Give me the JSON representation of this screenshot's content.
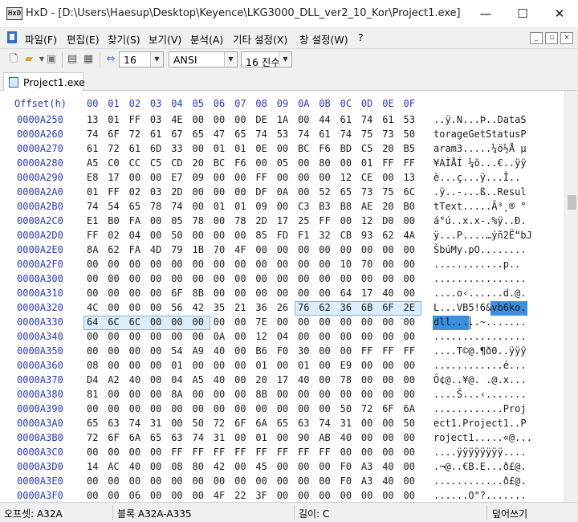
{
  "window": {
    "app_icon_text": "HxD",
    "title": "HxD - [D:\\Users\\Haesup\\Desktop\\Keyence\\LKG3000_DLL_ver2_10_Kor\\Project1.exe]",
    "minimize_glyph": "—",
    "maximize_glyph": "☐",
    "close_glyph": "✕"
  },
  "menu": {
    "items": [
      "파일(F)",
      "편집(E)",
      "찾기(S)",
      "보기(V)",
      "분석(A)",
      "기타 설정(X)",
      "창 설정(W)",
      "?"
    ],
    "mdi_buttons": [
      "_",
      "▫",
      "×"
    ]
  },
  "toolbar": {
    "bytes_per_row": "16",
    "charset": "ANSI",
    "offset_base": "16 진수"
  },
  "tab": {
    "label": "Project1.exe"
  },
  "editor": {
    "header_label": "Offset(h)",
    "column_headers": [
      "00",
      "01",
      "02",
      "03",
      "04",
      "05",
      "06",
      "07",
      "08",
      "09",
      "0A",
      "0B",
      "0C",
      "0D",
      "0E",
      "0F"
    ],
    "rows": [
      {
        "offset": "0000A250",
        "bytes": [
          "13",
          "01",
          "FF",
          "03",
          "4E",
          "00",
          "00",
          "00",
          "DE",
          "1A",
          "00",
          "44",
          "61",
          "74",
          "61",
          "53"
        ],
        "ascii": "..ÿ.N...Þ..DataS"
      },
      {
        "offset": "0000A260",
        "bytes": [
          "74",
          "6F",
          "72",
          "61",
          "67",
          "65",
          "47",
          "65",
          "74",
          "53",
          "74",
          "61",
          "74",
          "75",
          "73",
          "50"
        ],
        "ascii": "torageGetStatusP"
      },
      {
        "offset": "0000A270",
        "bytes": [
          "61",
          "72",
          "61",
          "6D",
          "33",
          "00",
          "01",
          "01",
          "0E",
          "00",
          "BC",
          "F6",
          "BD",
          "C5",
          "20",
          "B5"
        ],
        "ascii": "aram3.....¼ö½Å µ"
      },
      {
        "offset": "0000A280",
        "bytes": [
          "A5",
          "C0",
          "CC",
          "C5",
          "CD",
          "20",
          "BC",
          "F6",
          "00",
          "05",
          "00",
          "80",
          "00",
          "01",
          "FF",
          "FF"
        ],
        "ascii": "¥ÀÌÅÍ ¼ö...€..ÿÿ"
      },
      {
        "offset": "0000A290",
        "bytes": [
          "E8",
          "17",
          "00",
          "00",
          "E7",
          "09",
          "00",
          "00",
          "FF",
          "00",
          "00",
          "00",
          "12",
          "CE",
          "00",
          "13"
        ],
        "ascii": "è...ç...ÿ...Î.."
      },
      {
        "offset": "0000A2A0",
        "bytes": [
          "01",
          "FF",
          "02",
          "03",
          "2D",
          "00",
          "00",
          "00",
          "DF",
          "0A",
          "00",
          "52",
          "65",
          "73",
          "75",
          "6C"
        ],
        "ascii": ".ÿ..-...ß..Resul"
      },
      {
        "offset": "0000A2B0",
        "bytes": [
          "74",
          "54",
          "65",
          "78",
          "74",
          "00",
          "01",
          "01",
          "09",
          "00",
          "C3",
          "B3",
          "B8",
          "AE",
          "20",
          "B0"
        ],
        "ascii": "tText.....Ã³¸® °"
      },
      {
        "offset": "0000A2C0",
        "bytes": [
          "E1",
          "B0",
          "FA",
          "00",
          "05",
          "78",
          "00",
          "78",
          "2D",
          "17",
          "25",
          "FF",
          "00",
          "12",
          "D0",
          "00"
        ],
        "ascii": "á°ú..x.x-.%ÿ..Ð."
      },
      {
        "offset": "0000A2D0",
        "bytes": [
          "FF",
          "02",
          "04",
          "00",
          "50",
          "00",
          "00",
          "00",
          "85",
          "FD",
          "F1",
          "32",
          "CB",
          "93",
          "62",
          "4A"
        ],
        "ascii": "ÿ...P....…ýñ2Ë“bJ"
      },
      {
        "offset": "0000A2E0",
        "bytes": [
          "8A",
          "62",
          "FA",
          "4D",
          "79",
          "1B",
          "70",
          "4F",
          "00",
          "00",
          "00",
          "00",
          "00",
          "00",
          "00",
          "00"
        ],
        "ascii": "ŠbúMy.pO........"
      },
      {
        "offset": "0000A2F0",
        "bytes": [
          "00",
          "00",
          "00",
          "00",
          "00",
          "00",
          "00",
          "00",
          "00",
          "00",
          "00",
          "00",
          "10",
          "70",
          "00",
          "00"
        ],
        "ascii": "............p.."
      },
      {
        "offset": "0000A300",
        "bytes": [
          "00",
          "00",
          "00",
          "00",
          "00",
          "00",
          "00",
          "00",
          "00",
          "00",
          "00",
          "00",
          "00",
          "00",
          "00",
          "00"
        ],
        "ascii": "................"
      },
      {
        "offset": "0000A310",
        "bytes": [
          "00",
          "00",
          "00",
          "00",
          "6F",
          "8B",
          "00",
          "00",
          "00",
          "00",
          "00",
          "00",
          "64",
          "17",
          "40",
          "00"
        ],
        "ascii": "....o‹......d.@."
      },
      {
        "offset": "0000A320",
        "bytes": [
          "4C",
          "00",
          "00",
          "00",
          "56",
          "42",
          "35",
          "21",
          "36",
          "26",
          "76",
          "62",
          "36",
          "6B",
          "6F",
          "2E"
        ],
        "ascii": "L...VB5!6&vb6ko."
      },
      {
        "offset": "0000A330",
        "bytes": [
          "64",
          "6C",
          "6C",
          "00",
          "00",
          "00",
          "00",
          "00",
          "7E",
          "00",
          "00",
          "00",
          "00",
          "00",
          "00",
          "00"
        ],
        "ascii": "dll.....~......."
      },
      {
        "offset": "0000A340",
        "bytes": [
          "00",
          "00",
          "00",
          "00",
          "00",
          "00",
          "0A",
          "00",
          "12",
          "04",
          "00",
          "00",
          "00",
          "00",
          "00",
          "00"
        ],
        "ascii": "................"
      },
      {
        "offset": "0000A350",
        "bytes": [
          "00",
          "00",
          "00",
          "00",
          "54",
          "A9",
          "40",
          "00",
          "B6",
          "F0",
          "30",
          "00",
          "00",
          "FF",
          "FF",
          "FF"
        ],
        "ascii": "....T©@.¶ð0..ÿÿÿ"
      },
      {
        "offset": "0000A360",
        "bytes": [
          "08",
          "00",
          "00",
          "00",
          "01",
          "00",
          "00",
          "00",
          "01",
          "00",
          "01",
          "00",
          "E9",
          "00",
          "00",
          "00"
        ],
        "ascii": "............é..."
      },
      {
        "offset": "0000A370",
        "bytes": [
          "D4",
          "A2",
          "40",
          "00",
          "04",
          "A5",
          "40",
          "00",
          "20",
          "17",
          "40",
          "00",
          "78",
          "00",
          "00",
          "00"
        ],
        "ascii": "Ô¢@..¥@. .@.x..."
      },
      {
        "offset": "0000A380",
        "bytes": [
          "81",
          "00",
          "00",
          "00",
          "8A",
          "00",
          "00",
          "00",
          "8B",
          "00",
          "00",
          "00",
          "00",
          "00",
          "00",
          "00"
        ],
        "ascii": "....Š...‹......."
      },
      {
        "offset": "0000A390",
        "bytes": [
          "00",
          "00",
          "00",
          "00",
          "00",
          "00",
          "00",
          "00",
          "00",
          "00",
          "00",
          "00",
          "50",
          "72",
          "6F",
          "6A"
        ],
        "ascii": "............Proj"
      },
      {
        "offset": "0000A3A0",
        "bytes": [
          "65",
          "63",
          "74",
          "31",
          "00",
          "50",
          "72",
          "6F",
          "6A",
          "65",
          "63",
          "74",
          "31",
          "00",
          "00",
          "50"
        ],
        "ascii": "ect1.Project1..P"
      },
      {
        "offset": "0000A3B0",
        "bytes": [
          "72",
          "6F",
          "6A",
          "65",
          "63",
          "74",
          "31",
          "00",
          "01",
          "00",
          "90",
          "AB",
          "40",
          "00",
          "00",
          "00"
        ],
        "ascii": "roject1.....«@..."
      },
      {
        "offset": "0000A3C0",
        "bytes": [
          "00",
          "00",
          "00",
          "00",
          "FF",
          "FF",
          "FF",
          "FF",
          "FF",
          "FF",
          "FF",
          "FF",
          "00",
          "00",
          "00",
          "00"
        ],
        "ascii": "....ÿÿÿÿÿÿÿÿ...."
      },
      {
        "offset": "0000A3D0",
        "bytes": [
          "14",
          "AC",
          "40",
          "00",
          "08",
          "80",
          "42",
          "00",
          "45",
          "00",
          "00",
          "00",
          "F0",
          "A3",
          "40",
          "00"
        ],
        "ascii": ".¬@..€B.E...ð£@."
      },
      {
        "offset": "0000A3E0",
        "bytes": [
          "00",
          "00",
          "00",
          "00",
          "00",
          "00",
          "00",
          "00",
          "00",
          "00",
          "00",
          "00",
          "F0",
          "A3",
          "40",
          "00"
        ],
        "ascii": "............ð£@."
      },
      {
        "offset": "0000A3F0",
        "bytes": [
          "00",
          "00",
          "06",
          "00",
          "00",
          "00",
          "4F",
          "22",
          "3F",
          "00",
          "00",
          "00",
          "00",
          "00",
          "00",
          "00"
        ],
        "ascii": "......O\"?......."
      }
    ]
  },
  "statusbar": {
    "offset": "오프셋: A32A",
    "block": "블록 A32A-A335",
    "length": "길이: C",
    "mode": "덮어쓰기"
  }
}
